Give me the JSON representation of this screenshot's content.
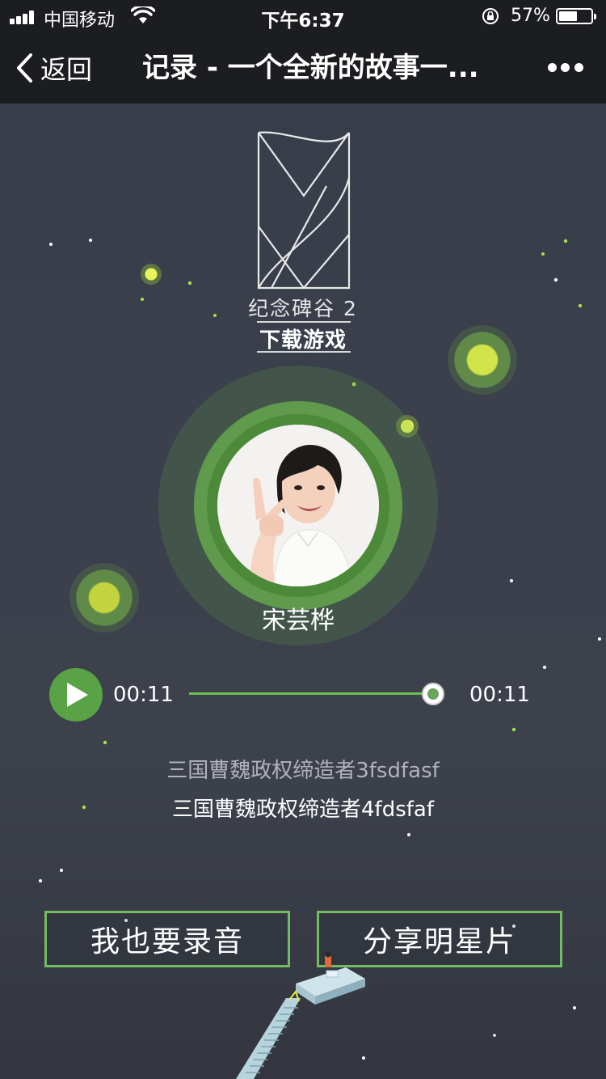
{
  "status_bar": {
    "carrier": "中国移动",
    "time": "下午6:37",
    "battery_percent": "57%",
    "battery_level": 0.57,
    "icons": [
      "signal-icon",
      "wifi-icon",
      "orientation-lock-icon",
      "battery-icon"
    ]
  },
  "nav": {
    "back_label": "返回",
    "title": "记录 - 一个全新的故事一...",
    "icons": [
      "back-chevron-icon",
      "more-icon"
    ]
  },
  "game": {
    "logo_text": "纪念碑谷 2",
    "download_label": "下载游戏",
    "logo_icon": "monument-valley-logo-icon"
  },
  "player": {
    "star_name": "宋芸桦",
    "current_time": "00:11",
    "total_time": "00:11",
    "progress": 1.0,
    "play_icon": "play-icon"
  },
  "lyrics": {
    "line1": "三国曹魏政权缔造者3fsdfasf",
    "line2": "三国曹魏政权缔造者4fdsfaf"
  },
  "actions": {
    "record_label": "我也要录音",
    "share_label": "分享明星片"
  },
  "colors": {
    "accent_green": "#5aa246",
    "button_border": "#74bb62",
    "background": "#3b404c",
    "bar": "#1c1d20"
  }
}
